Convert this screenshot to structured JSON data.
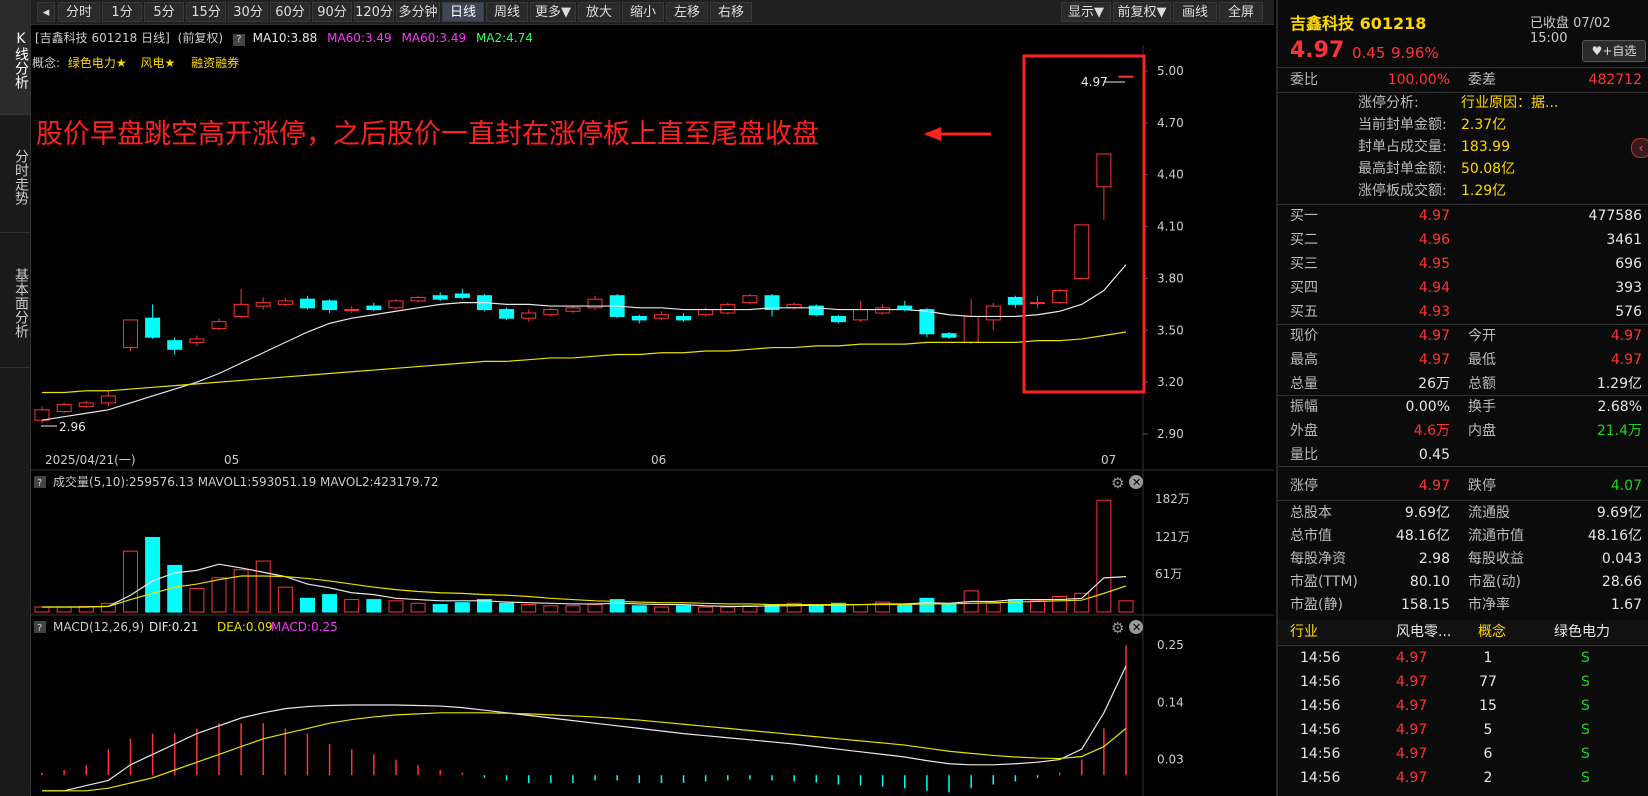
{
  "vtabs": [
    {
      "label": "K线分析",
      "active": true
    },
    {
      "label": "分时走势",
      "active": false
    },
    {
      "label": "基本面分析",
      "active": false
    }
  ],
  "toolbar": {
    "back_icon": "back-icon",
    "periods": [
      "分时",
      "1分",
      "5分",
      "15分",
      "30分",
      "60分",
      "90分",
      "120分",
      "多分钟",
      "日线",
      "周线",
      "更多▼"
    ],
    "active_period": "日线",
    "actions": [
      "放大",
      "缩小",
      "左移",
      "右移"
    ],
    "right": [
      "显示▼",
      "前复权▼",
      "画线",
      "全屏"
    ]
  },
  "chart_header": {
    "name": "[吉鑫科技 601218 日线]",
    "adjust": "(前复权)",
    "ma10": "MA10:3.88",
    "ma60a": "MA60:3.49",
    "ma60b": "MA60:3.49",
    "ma2": "MA2:4.74",
    "concept_label": "概念:",
    "concepts": [
      "绿色电力★",
      "风电★",
      "融资融券"
    ]
  },
  "annotation": {
    "text": "股价早盘跳空高开涨停，之后股价一直封在涨停板上直至尾盘收盘",
    "high_label": "4.97",
    "low_label": "2.96"
  },
  "colors": {
    "up": "#ff3333",
    "down": "#00ffff",
    "ma10": "#e8e8e8",
    "ma60": "#e8e000",
    "annotation": "#ff2020"
  },
  "chart_data": [
    {
      "type": "candlestick",
      "title": "吉鑫科技 601218 日线",
      "yticks": [
        "5.00",
        "4.70",
        "4.40",
        "4.10",
        "3.80",
        "3.50",
        "3.20",
        "2.90"
      ],
      "ylim": [
        2.87,
        5.1
      ],
      "xlabels": [
        "2025/04/21(一)",
        "05",
        "06",
        "07"
      ],
      "candles": [
        {
          "o": 2.98,
          "c": 3.04,
          "h": 3.06,
          "l": 2.96,
          "up": true
        },
        {
          "o": 3.03,
          "c": 3.07,
          "h": 3.08,
          "l": 3.02,
          "up": true
        },
        {
          "o": 3.06,
          "c": 3.08,
          "h": 3.09,
          "l": 3.05,
          "up": true
        },
        {
          "o": 3.08,
          "c": 3.12,
          "h": 3.15,
          "l": 3.06,
          "up": true
        },
        {
          "o": 3.4,
          "c": 3.56,
          "h": 3.56,
          "l": 3.38,
          "up": true
        },
        {
          "o": 3.57,
          "c": 3.46,
          "h": 3.65,
          "l": 3.45,
          "up": false
        },
        {
          "o": 3.44,
          "c": 3.39,
          "h": 3.46,
          "l": 3.36,
          "up": false
        },
        {
          "o": 3.43,
          "c": 3.45,
          "h": 3.47,
          "l": 3.41,
          "up": true
        },
        {
          "o": 3.51,
          "c": 3.55,
          "h": 3.57,
          "l": 3.5,
          "up": true
        },
        {
          "o": 3.58,
          "c": 3.65,
          "h": 3.74,
          "l": 3.57,
          "up": true
        },
        {
          "o": 3.64,
          "c": 3.66,
          "h": 3.69,
          "l": 3.62,
          "up": true
        },
        {
          "o": 3.65,
          "c": 3.67,
          "h": 3.69,
          "l": 3.64,
          "up": true
        },
        {
          "o": 3.68,
          "c": 3.63,
          "h": 3.7,
          "l": 3.62,
          "up": false
        },
        {
          "o": 3.67,
          "c": 3.62,
          "h": 3.68,
          "l": 3.6,
          "up": false
        },
        {
          "o": 3.62,
          "c": 3.62,
          "h": 3.64,
          "l": 3.6,
          "up": true
        },
        {
          "o": 3.64,
          "c": 3.62,
          "h": 3.66,
          "l": 3.61,
          "up": false
        },
        {
          "o": 3.63,
          "c": 3.67,
          "h": 3.68,
          "l": 3.62,
          "up": true
        },
        {
          "o": 3.67,
          "c": 3.69,
          "h": 3.7,
          "l": 3.66,
          "up": true
        },
        {
          "o": 3.7,
          "c": 3.68,
          "h": 3.72,
          "l": 3.67,
          "up": false
        },
        {
          "o": 3.71,
          "c": 3.69,
          "h": 3.74,
          "l": 3.68,
          "up": false
        },
        {
          "o": 3.7,
          "c": 3.62,
          "h": 3.71,
          "l": 3.61,
          "up": false
        },
        {
          "o": 3.62,
          "c": 3.57,
          "h": 3.63,
          "l": 3.56,
          "up": false
        },
        {
          "o": 3.57,
          "c": 3.6,
          "h": 3.62,
          "l": 3.55,
          "up": true
        },
        {
          "o": 3.59,
          "c": 3.62,
          "h": 3.63,
          "l": 3.58,
          "up": true
        },
        {
          "o": 3.61,
          "c": 3.63,
          "h": 3.64,
          "l": 3.6,
          "up": true
        },
        {
          "o": 3.63,
          "c": 3.68,
          "h": 3.7,
          "l": 3.62,
          "up": true
        },
        {
          "o": 3.7,
          "c": 3.58,
          "h": 3.71,
          "l": 3.57,
          "up": false
        },
        {
          "o": 3.58,
          "c": 3.56,
          "h": 3.59,
          "l": 3.54,
          "up": false
        },
        {
          "o": 3.57,
          "c": 3.59,
          "h": 3.61,
          "l": 3.56,
          "up": true
        },
        {
          "o": 3.58,
          "c": 3.56,
          "h": 3.6,
          "l": 3.55,
          "up": false
        },
        {
          "o": 3.59,
          "c": 3.62,
          "h": 3.63,
          "l": 3.58,
          "up": true
        },
        {
          "o": 3.6,
          "c": 3.65,
          "h": 3.66,
          "l": 3.59,
          "up": true
        },
        {
          "o": 3.66,
          "c": 3.7,
          "h": 3.71,
          "l": 3.65,
          "up": true
        },
        {
          "o": 3.7,
          "c": 3.62,
          "h": 3.71,
          "l": 3.58,
          "up": false
        },
        {
          "o": 3.63,
          "c": 3.65,
          "h": 3.66,
          "l": 3.62,
          "up": true
        },
        {
          "o": 3.64,
          "c": 3.59,
          "h": 3.65,
          "l": 3.58,
          "up": false
        },
        {
          "o": 3.58,
          "c": 3.55,
          "h": 3.59,
          "l": 3.54,
          "up": false
        },
        {
          "o": 3.56,
          "c": 3.62,
          "h": 3.67,
          "l": 3.55,
          "up": true
        },
        {
          "o": 3.6,
          "c": 3.63,
          "h": 3.65,
          "l": 3.59,
          "up": true
        },
        {
          "o": 3.64,
          "c": 3.62,
          "h": 3.67,
          "l": 3.61,
          "up": false
        },
        {
          "o": 3.62,
          "c": 3.48,
          "h": 3.63,
          "l": 3.46,
          "up": false
        },
        {
          "o": 3.48,
          "c": 3.46,
          "h": 3.49,
          "l": 3.45,
          "up": false
        },
        {
          "o": 3.43,
          "c": 3.58,
          "h": 3.68,
          "l": 3.42,
          "up": true
        },
        {
          "o": 3.56,
          "c": 3.64,
          "h": 3.66,
          "l": 3.5,
          "up": true
        },
        {
          "o": 3.69,
          "c": 3.65,
          "h": 3.7,
          "l": 3.63,
          "up": false
        },
        {
          "o": 3.66,
          "c": 3.66,
          "h": 3.7,
          "l": 3.63,
          "up": true
        },
        {
          "o": 3.66,
          "c": 3.73,
          "h": 3.74,
          "l": 3.65,
          "up": true
        },
        {
          "o": 3.8,
          "c": 4.11,
          "h": 4.11,
          "l": 3.8,
          "up": true
        },
        {
          "o": 4.33,
          "c": 4.52,
          "h": 4.52,
          "l": 4.14,
          "up": true
        },
        {
          "o": 4.97,
          "c": 4.97,
          "h": 4.97,
          "l": 4.97,
          "up": true
        }
      ],
      "ma10": [
        2.98,
        3.0,
        3.02,
        3.04,
        3.08,
        3.12,
        3.16,
        3.2,
        3.25,
        3.31,
        3.37,
        3.43,
        3.49,
        3.54,
        3.57,
        3.59,
        3.61,
        3.63,
        3.65,
        3.66,
        3.66,
        3.65,
        3.65,
        3.64,
        3.64,
        3.64,
        3.64,
        3.63,
        3.63,
        3.62,
        3.62,
        3.62,
        3.62,
        3.63,
        3.63,
        3.63,
        3.62,
        3.62,
        3.62,
        3.62,
        3.61,
        3.59,
        3.58,
        3.58,
        3.58,
        3.59,
        3.61,
        3.65,
        3.73,
        3.88
      ],
      "ma60": [
        3.14,
        3.14,
        3.15,
        3.15,
        3.16,
        3.17,
        3.18,
        3.19,
        3.2,
        3.21,
        3.22,
        3.23,
        3.24,
        3.25,
        3.26,
        3.27,
        3.28,
        3.29,
        3.3,
        3.31,
        3.32,
        3.32,
        3.33,
        3.34,
        3.34,
        3.35,
        3.36,
        3.36,
        3.37,
        3.37,
        3.38,
        3.38,
        3.39,
        3.4,
        3.4,
        3.41,
        3.41,
        3.42,
        3.42,
        3.42,
        3.43,
        3.43,
        3.43,
        3.43,
        3.43,
        3.44,
        3.44,
        3.45,
        3.47,
        3.49
      ]
    },
    {
      "type": "bar",
      "title": "成交量(5,10)",
      "header": ":259576.13 MAVOL1:593051.19 MAVOL2:423179.72",
      "yticks": [
        "182万",
        "121万",
        "61万"
      ],
      "ylim": [
        0,
        190
      ],
      "values": [
        8,
        8,
        9,
        14,
        98,
        120,
        75,
        38,
        55,
        68,
        82,
        40,
        22,
        28,
        20,
        20,
        18,
        14,
        12,
        15,
        20,
        14,
        12,
        10,
        10,
        12,
        20,
        10,
        8,
        10,
        8,
        8,
        10,
        12,
        14,
        10,
        14,
        12,
        16,
        12,
        22,
        12,
        34,
        14,
        20,
        18,
        25,
        30,
        180,
        18
      ],
      "up": [
        true,
        true,
        true,
        true,
        true,
        false,
        false,
        true,
        true,
        true,
        true,
        true,
        false,
        false,
        true,
        false,
        true,
        true,
        false,
        false,
        false,
        false,
        true,
        true,
        true,
        true,
        false,
        false,
        true,
        false,
        true,
        true,
        true,
        false,
        true,
        false,
        false,
        true,
        true,
        false,
        false,
        false,
        true,
        true,
        false,
        true,
        true,
        true,
        true,
        true
      ],
      "mavol1": [
        8,
        8,
        8,
        9,
        27,
        50,
        63,
        67,
        77,
        71,
        64,
        57,
        45,
        39,
        31,
        28,
        22,
        20,
        18,
        18,
        18,
        16,
        15,
        14,
        13,
        13,
        14,
        13,
        12,
        12,
        10,
        9,
        9,
        10,
        10,
        11,
        11,
        12,
        13,
        13,
        15,
        14,
        17,
        17,
        20,
        20,
        20,
        22,
        55,
        57
      ],
      "mavol2": [
        8,
        8,
        8,
        9,
        20,
        30,
        40,
        45,
        52,
        58,
        58,
        57,
        54,
        50,
        45,
        40,
        36,
        33,
        31,
        30,
        28,
        27,
        25,
        22,
        20,
        18,
        17,
        16,
        15,
        15,
        14,
        13,
        13,
        12,
        12,
        12,
        12,
        12,
        12,
        12,
        13,
        13,
        14,
        15,
        16,
        17,
        18,
        19,
        30,
        42
      ]
    },
    {
      "type": "bar",
      "title": "MACD(12,26,9)",
      "dif": "DIF:0.21",
      "dea": "DEA:0.09",
      "macd": "MACD:0.25",
      "yticks": [
        "0.25",
        "0.14",
        "0.03"
      ],
      "ylim": [
        -0.04,
        0.26
      ],
      "macd_values": [
        0.005,
        0.01,
        0.02,
        0.05,
        0.07,
        0.08,
        0.08,
        0.09,
        0.1,
        0.1,
        0.1,
        0.09,
        0.08,
        0.06,
        0.05,
        0.04,
        0.03,
        0.02,
        0.01,
        0.005,
        -0.005,
        -0.01,
        -0.015,
        -0.015,
        -0.015,
        -0.01,
        -0.01,
        -0.015,
        -0.015,
        -0.015,
        -0.012,
        -0.01,
        -0.008,
        -0.01,
        -0.012,
        -0.014,
        -0.018,
        -0.02,
        -0.022,
        -0.025,
        -0.03,
        -0.033,
        -0.025,
        -0.018,
        -0.012,
        -0.005,
        0.005,
        0.03,
        0.09,
        0.25
      ],
      "dif_values": [
        -0.03,
        -0.03,
        -0.02,
        -0.01,
        0.02,
        0.04,
        0.06,
        0.08,
        0.095,
        0.11,
        0.12,
        0.128,
        0.132,
        0.134,
        0.135,
        0.135,
        0.135,
        0.134,
        0.133,
        0.13,
        0.125,
        0.12,
        0.115,
        0.11,
        0.105,
        0.1,
        0.095,
        0.09,
        0.085,
        0.08,
        0.076,
        0.072,
        0.068,
        0.064,
        0.06,
        0.055,
        0.05,
        0.045,
        0.04,
        0.035,
        0.028,
        0.022,
        0.02,
        0.02,
        0.022,
        0.025,
        0.03,
        0.05,
        0.12,
        0.21
      ],
      "dea_values": [
        -0.03,
        -0.03,
        -0.03,
        -0.025,
        -0.015,
        -0.005,
        0.01,
        0.025,
        0.04,
        0.055,
        0.07,
        0.08,
        0.09,
        0.1,
        0.107,
        0.112,
        0.116,
        0.118,
        0.12,
        0.12,
        0.12,
        0.119,
        0.118,
        0.116,
        0.114,
        0.112,
        0.109,
        0.106,
        0.102,
        0.098,
        0.094,
        0.09,
        0.086,
        0.082,
        0.078,
        0.074,
        0.07,
        0.066,
        0.062,
        0.058,
        0.052,
        0.046,
        0.042,
        0.038,
        0.035,
        0.033,
        0.032,
        0.036,
        0.055,
        0.09
      ]
    }
  ],
  "quote": {
    "title": "吉鑫科技 601218",
    "status": "已收盘 07/02 15:00",
    "price": "4.97",
    "change": "0.45",
    "pct": "9.96%",
    "watch_btn": "♥+自选",
    "weibi_label": "委比",
    "weibi": "100.00%",
    "weicha_label": "委差",
    "weicha": "482712",
    "limit_analysis": [
      {
        "label": "涨停分析:",
        "value": "行业原因：据..."
      },
      {
        "label": "当前封单金额:",
        "value": "2.37亿"
      },
      {
        "label": "封单占成交量:",
        "value": "183.99"
      },
      {
        "label": "最高封单金额:",
        "value": "50.08亿"
      },
      {
        "label": "涨停板成交额:",
        "value": "1.29亿"
      }
    ],
    "bids": [
      {
        "label": "买一",
        "price": "4.97",
        "vol": "477586"
      },
      {
        "label": "买二",
        "price": "4.96",
        "vol": "3461"
      },
      {
        "label": "买三",
        "price": "4.95",
        "vol": "696"
      },
      {
        "label": "买四",
        "price": "4.94",
        "vol": "393"
      },
      {
        "label": "买五",
        "price": "4.93",
        "vol": "576"
      }
    ],
    "stats1": [
      {
        "l1": "现价",
        "v1": "4.97",
        "c1": "red",
        "l2": "今开",
        "v2": "4.97",
        "c2": "red"
      },
      {
        "l1": "最高",
        "v1": "4.97",
        "c1": "red",
        "l2": "最低",
        "v2": "4.97",
        "c2": "red"
      },
      {
        "l1": "总量",
        "v1": "26万",
        "c1": "white",
        "l2": "总额",
        "v2": "1.29亿",
        "c2": "white"
      }
    ],
    "stats2": [
      {
        "l1": "振幅",
        "v1": "0.00%",
        "c1": "white",
        "l2": "换手",
        "v2": "2.68%",
        "c2": "white"
      },
      {
        "l1": "外盘",
        "v1": "4.6万",
        "c1": "red",
        "l2": "内盘",
        "v2": "21.4万",
        "c2": "green"
      },
      {
        "l1": "量比",
        "v1": "0.45",
        "c1": "white",
        "l2": "",
        "v2": "",
        "c2": "white"
      }
    ],
    "limits": {
      "up_label": "涨停",
      "up": "4.97",
      "down_label": "跌停",
      "down": "4.07"
    },
    "fundamentals": [
      {
        "l1": "总股本",
        "v1": "9.69亿",
        "l2": "流通股",
        "v2": "9.69亿"
      },
      {
        "l1": "总市值",
        "v1": "48.16亿",
        "l2": "流通市值",
        "v2": "48.16亿"
      },
      {
        "l1": "每股净资",
        "v1": "2.98",
        "l2": "每股收益",
        "v2": "0.043"
      },
      {
        "l1": "市盈(TTM)",
        "v1": "80.10",
        "l2": "市盈(动)",
        "v2": "28.66"
      },
      {
        "l1": "市盈(静)",
        "v1": "158.15",
        "l2": "市净率",
        "v2": "1.67"
      }
    ],
    "industry": {
      "l1": "行业",
      "v1": "风电零...",
      "l2": "概念",
      "v2": "绿色电力"
    },
    "ticks": [
      {
        "time": "14:56",
        "price": "4.97",
        "vol": "1",
        "flag": "S"
      },
      {
        "time": "14:56",
        "price": "4.97",
        "vol": "77",
        "flag": "S"
      },
      {
        "time": "14:56",
        "price": "4.97",
        "vol": "15",
        "flag": "S"
      },
      {
        "time": "14:56",
        "price": "4.97",
        "vol": "5",
        "flag": "S"
      },
      {
        "time": "14:56",
        "price": "4.97",
        "vol": "6",
        "flag": "S"
      },
      {
        "time": "14:56",
        "price": "4.97",
        "vol": "2",
        "flag": "S"
      }
    ]
  }
}
